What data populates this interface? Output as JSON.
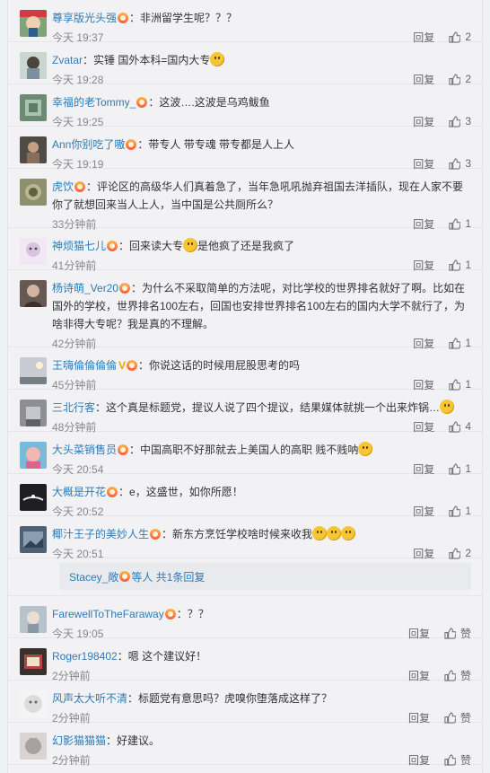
{
  "comments": [
    {
      "username": "尊享版光头强",
      "text": "非洲留学生呢？？？",
      "time": "今天 19:37",
      "reply_label": "回复",
      "likes": "2",
      "like_state": "like"
    },
    {
      "username": "Zvatar",
      "text": "实锤 国外本科=国内大专",
      "time": "今天 19:28",
      "reply_label": "回复",
      "likes": "2",
      "like_state": "like"
    },
    {
      "username": "幸福的老Tommy_",
      "text": "这波….这波是乌鸡鲅鱼",
      "time": "今天 19:25",
      "reply_label": "回复",
      "likes": "3",
      "like_state": "like"
    },
    {
      "username": "Ann你别吃了嗷",
      "text": "带专人 带专魂 带专都是人上人",
      "time": "今天 19:19",
      "reply_label": "回复",
      "likes": "3",
      "like_state": "like"
    },
    {
      "username": "虎饮",
      "text": "评论区的高级华人们真着急了，当年急吼吼抛弃祖国去洋插队，现在人家不要你了就想回来当人上人，当中国是公共厕所么？",
      "time": "33分钟前",
      "reply_label": "回复",
      "likes": "1",
      "like_state": "like"
    },
    {
      "username": "神烦猫七儿",
      "text_before": "回来读大专",
      "text_after": "是他疯了还是我疯了",
      "time": "41分钟前",
      "reply_label": "回复",
      "likes": "1",
      "like_state": "like"
    },
    {
      "username": "杨诗萌_Ver20",
      "text": "为什么不采取简单的方法呢，对比学校的世界排名就好了啊。比如在国外的学校，世界排名100左右，回国也安排世界排名100左右的国内大学不就行了，为啥非得大专呢？我是真的不理解。",
      "time": "42分钟前",
      "reply_label": "回复",
      "likes": "1",
      "like_state": "like"
    },
    {
      "username": "王嗨倫倫倫倫",
      "vip": "V",
      "text": "你说这话的时候用屁股思考的吗",
      "time": "45分钟前",
      "reply_label": "回复",
      "likes": "1",
      "like_state": "like"
    },
    {
      "username": "三北行客",
      "text": "这个真是标题党，提议人说了四个提议，结果媒体就挑一个出来炸锅…",
      "time": "48分钟前",
      "reply_label": "回复",
      "likes": "4",
      "like_state": "like"
    },
    {
      "username": "大头菜销售员",
      "text": "中国高职不好那就去上美国人的高职 贱不贱呐",
      "time": "今天 20:54",
      "reply_label": "回复",
      "likes": "1",
      "like_state": "like"
    },
    {
      "username": "大概是开花",
      "text": "e，这盛世，如你所愿！",
      "time": "今天 20:52",
      "reply_label": "回复",
      "likes": "1",
      "like_state": "like"
    },
    {
      "username": "椰汁王子的美妙人生",
      "text": "新东方烹饪学校啥时候来收我",
      "time": "今天 20:51",
      "reply_label": "回复",
      "likes": "2",
      "like_state": "like"
    }
  ],
  "reply_summary": {
    "username": "Stacey_敞",
    "text": "等人 共1条回复"
  },
  "comments_after": [
    {
      "username": "FarewellToTheFaraway",
      "text": "？？",
      "time": "今天 19:05",
      "reply_label": "回复",
      "likes": "赞",
      "like_state": "zan"
    },
    {
      "username": "Roger198402",
      "text": "嗯 这个建议好！",
      "time": "2分钟前",
      "reply_label": "回复",
      "likes": "赞",
      "like_state": "zan"
    },
    {
      "username": "风声太大听不清",
      "text": "标题党有意思吗？虎嗅你堕落成这样了？",
      "time": "2分钟前",
      "reply_label": "回复",
      "likes": "赞",
      "like_state": "zan"
    },
    {
      "username": "幻影猫猫猫",
      "text": "好建议。",
      "time": "2分钟前",
      "reply_label": "回复",
      "likes": "赞",
      "like_state": "zan"
    }
  ]
}
